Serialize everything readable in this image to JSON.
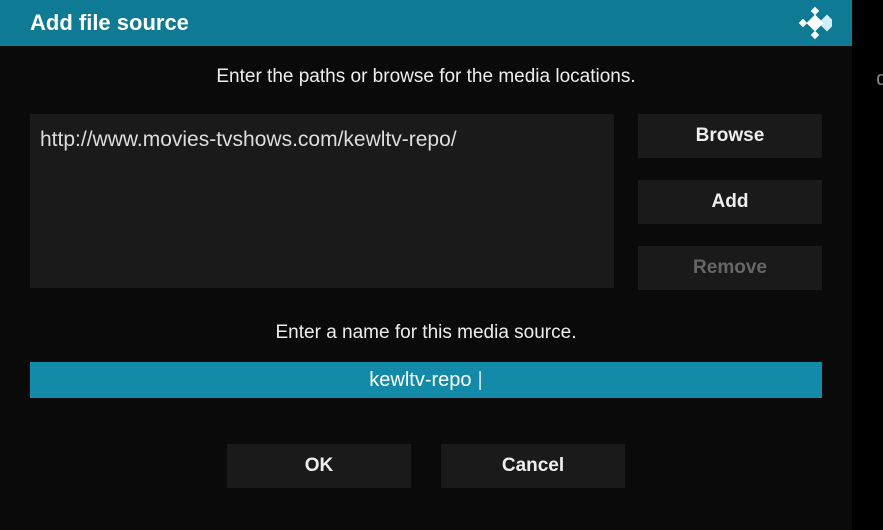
{
  "header": {
    "title": "Add file source"
  },
  "background": {
    "partial_text": "dow"
  },
  "instructions": {
    "paths": "Enter the paths or browse for the media locations.",
    "name": "Enter a name for this media source."
  },
  "paths": {
    "entries": [
      "http://www.movies-tvshows.com/kewltv-repo/"
    ]
  },
  "side_buttons": {
    "browse": "Browse",
    "add": "Add",
    "remove": "Remove"
  },
  "name_input": {
    "value": "kewltv-repo"
  },
  "bottom_buttons": {
    "ok": "OK",
    "cancel": "Cancel"
  },
  "colors": {
    "header_bg": "#0e7a93",
    "highlight_bg": "#128aa8"
  }
}
